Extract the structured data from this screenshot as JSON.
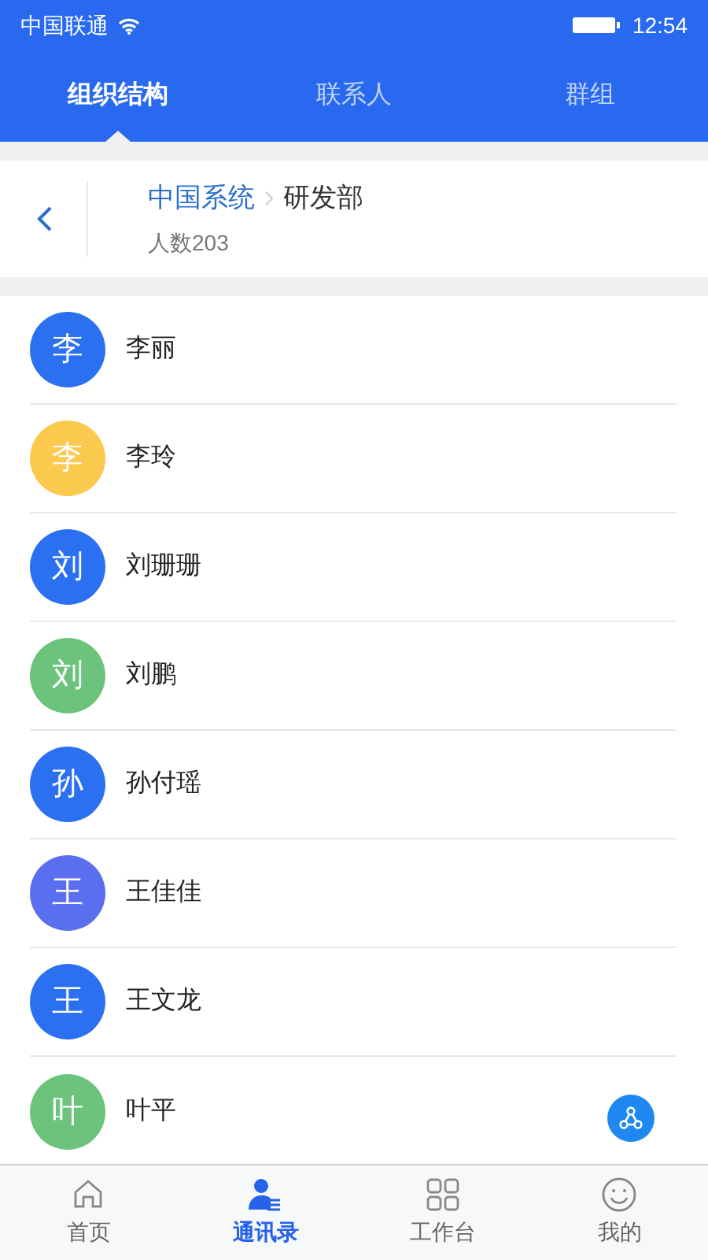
{
  "status_bar": {
    "carrier": "中国联通",
    "time": "12:54"
  },
  "tabs": [
    {
      "label": "组织结构",
      "selected": true
    },
    {
      "label": "联系人",
      "selected": false
    },
    {
      "label": "群组",
      "selected": false
    }
  ],
  "breadcrumb": {
    "path": "中国系统",
    "current": "研发部",
    "count": "人数203"
  },
  "members": [
    {
      "avatar": "李",
      "name": "李丽",
      "color": "#2a70f0"
    },
    {
      "avatar": "李",
      "name": "李玲",
      "color": "#fcc94f"
    },
    {
      "avatar": "刘",
      "name": "刘珊珊",
      "color": "#2a70f0"
    },
    {
      "avatar": "刘",
      "name": "刘鹏",
      "color": "#6cc47c"
    },
    {
      "avatar": "孙",
      "name": "孙付瑶",
      "color": "#2a70f0"
    },
    {
      "avatar": "王",
      "name": "王佳佳",
      "color": "#5a6ef0"
    },
    {
      "avatar": "王",
      "name": "王文龙",
      "color": "#2a70f0"
    },
    {
      "avatar": "叶",
      "name": "叶平",
      "color": "#6cc47c"
    }
  ],
  "bottom_nav": [
    {
      "label": "首页",
      "kind": "home",
      "selected": false
    },
    {
      "label": "通讯录",
      "kind": "contacts",
      "selected": true
    },
    {
      "label": "工作台",
      "kind": "grid",
      "selected": false
    },
    {
      "label": "我的",
      "kind": "smile",
      "selected": false
    }
  ]
}
